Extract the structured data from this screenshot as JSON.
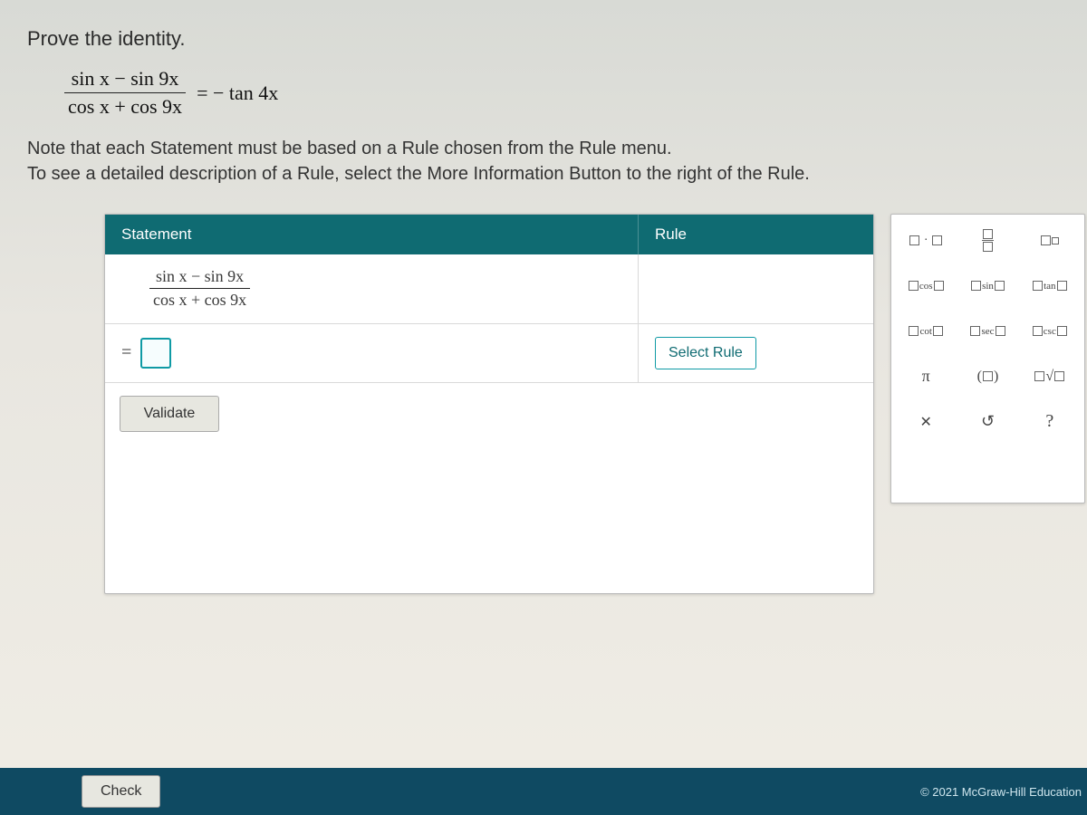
{
  "prompt": {
    "title": "Prove the identity.",
    "identity": {
      "numerator": "sin x − sin 9x",
      "denominator": "cos x + cos 9x",
      "rhs": "= − tan 4x"
    },
    "note_line1": "Note that each Statement must be based on a Rule chosen from the Rule menu.",
    "note_line2": "To see a detailed description of a Rule, select the More Information Button to the right of the Rule."
  },
  "table": {
    "header_statement": "Statement",
    "header_rule": "Rule",
    "first_statement": {
      "numerator": "sin x − sin 9x",
      "denominator": "cos x + cos 9x"
    },
    "equals_sign": "=",
    "select_rule_label": "Select Rule",
    "validate_label": "Validate"
  },
  "palette": {
    "items": [
      {
        "key": "multiply",
        "label": "▢ · ▢"
      },
      {
        "key": "fraction",
        "label": "▢/▢"
      },
      {
        "key": "power",
        "label": "▢^▢"
      },
      {
        "key": "cos",
        "label": "cos"
      },
      {
        "key": "sin",
        "label": "sin"
      },
      {
        "key": "tan",
        "label": "tan"
      },
      {
        "key": "cot",
        "label": "cot"
      },
      {
        "key": "sec",
        "label": "sec"
      },
      {
        "key": "csc",
        "label": "csc"
      },
      {
        "key": "pi",
        "label": "π"
      },
      {
        "key": "parens",
        "label": "( ▢ )"
      },
      {
        "key": "sqrt",
        "label": "▢√▢"
      },
      {
        "key": "clear",
        "label": "✕"
      },
      {
        "key": "undo",
        "label": "↺"
      },
      {
        "key": "help",
        "label": "?"
      }
    ]
  },
  "footer": {
    "check_label": "Check",
    "copyright": "© 2021 McGraw-Hill Education"
  }
}
